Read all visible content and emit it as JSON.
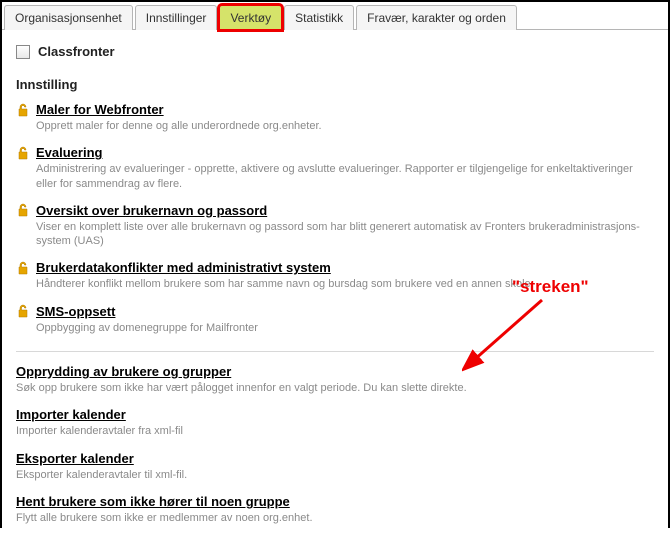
{
  "tabs": {
    "org": "Organisasjonsenhet",
    "settings": "Innstillinger",
    "tools": "Verktøy",
    "stats": "Statistikk",
    "absence": "Fravær, karakter og orden"
  },
  "classfronter_label": "Classfronter",
  "section_heading": "Innstilling",
  "items_locked": [
    {
      "title": "Maler for Webfronter",
      "desc": "Opprett maler for denne og alle underordnede org.enheter."
    },
    {
      "title": "Evaluering",
      "desc": "Administrering av evalueringer - opprette, aktivere og avslutte evalueringer. Rapporter er tilgjengelige for enkeltaktiveringer eller for sammendrag av flere."
    },
    {
      "title": "Oversikt over brukernavn og passord",
      "desc": "Viser en komplett liste over alle brukernavn og passord som har blitt generert automatisk av Fronters brukeradministrasjons-system (UAS)"
    },
    {
      "title": "Brukerdatakonflikter med administrativt system",
      "desc": "Håndterer konflikt mellom brukere som har samme navn og bursdag som brukere ved en annen skole."
    },
    {
      "title": "SMS-oppsett",
      "desc": "Oppbygging av domenegruppe for Mailfronter"
    }
  ],
  "items_plain": [
    {
      "title": "Opprydding av brukere og grupper",
      "desc": "Søk opp brukere som ikke har vært pålogget innenfor en valgt periode. Du kan slette direkte."
    },
    {
      "title": "Importer kalender",
      "desc": "Importer kalenderavtaler fra xml-fil"
    },
    {
      "title": "Eksporter kalender",
      "desc": "Eksporter kalenderavtaler til xml-fil."
    },
    {
      "title": "Hent brukere som ikke hører til noen gruppe",
      "desc": "Flytt alle brukere som ikke er medlemmer av noen org.enhet."
    }
  ],
  "annotation": "\"streken\""
}
